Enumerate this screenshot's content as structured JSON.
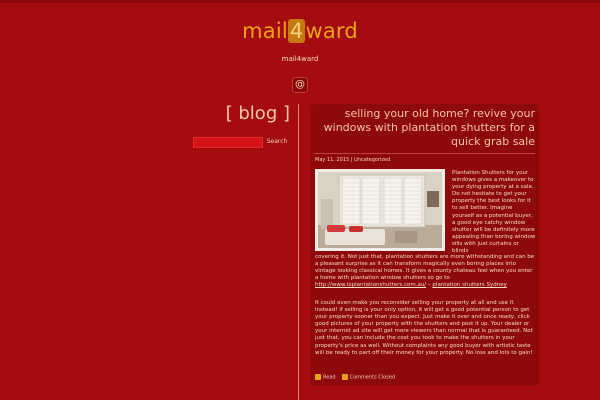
{
  "site": {
    "title_prefix": "mail",
    "title_highlight": "4",
    "title_suffix": "ward",
    "tagline": "mail4ward",
    "at_symbol": "@"
  },
  "sidebar": {
    "heading": "[ blog ]",
    "search_value": "",
    "search_button": "Search"
  },
  "post": {
    "title": "selling your old home? revive your windows with plantation shutters for a quick grab sale",
    "date": "May 11, 2015",
    "meta_separator": " | ",
    "category": "Uncategorized",
    "image_icon": "plantation-shutters-photo",
    "paragraph1_wrapped": "Plantation Shutters for your windows gives a makeover to your dying property at a sale. Do not hesitate to get your property the best looks for it to sell better. Imagine yourself as a potential buyer, a good eye catchy window shutter will be definitely more appealing than boring window sills with just curtains or blinds",
    "paragraph1_full": "covering it. Not just that, plantation shutters are more withstanding and can be a pleasant surprise as it can transform magically even boring places into vintage looking classical homes. It gives a county chateau feel when you enter a home with plantation window shutters so go to",
    "link_url": "http://www.tsplantationshutters.com.au/",
    "link_sep": " – ",
    "link_text": "plantation shutters Sydney",
    "paragraph2": "It could even make you reconsider selling your property at all and use it instead! If selling is your only option, it will get a good potential person to get your property sooner than you expect. Just make it over and once ready, click good pictures of your property with the shutters and post it up. Your dealer or your internet ad site will get more viewers than normal that is guaranteed. Not just that, you can include the cost you took to make the shutters in your property's price as well. Without complaints any good buyer with artistic taste will be ready to part off their money for your property. No loss and lots to gain!",
    "read_label": "Read",
    "comments_label": "Comments Closed"
  },
  "colors": {
    "background": "#a50c10",
    "post_background": "#8e090c",
    "accent": "#e8a418"
  }
}
